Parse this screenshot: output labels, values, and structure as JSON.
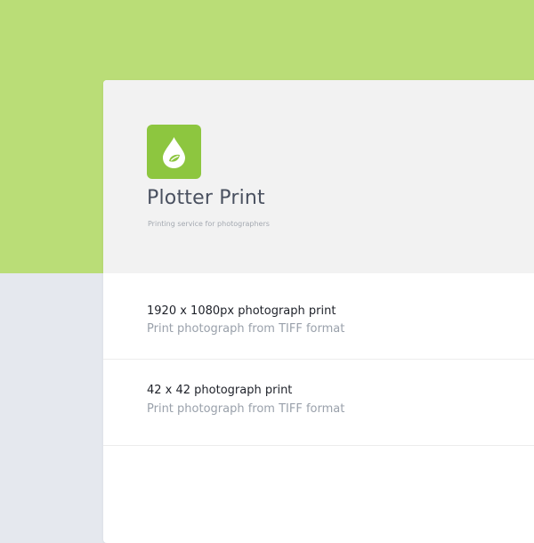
{
  "colors": {
    "accent_background": "#badd77",
    "page_background": "#e5e8ee",
    "logo_green": "#8dc63f",
    "card_header": "#f2f2f2",
    "title_text": "#4a5160",
    "muted_text": "#9aa1ab"
  },
  "header": {
    "logo_icon": "water-drop-leaf-icon",
    "title": "Plotter Print",
    "subtitle": "Printing service for photographers"
  },
  "items": [
    {
      "title": "1920 x 1080px photograph print",
      "subtitle": "Print photograph from TIFF format"
    },
    {
      "title": "42 x 42 photograph print",
      "subtitle": "Print photograph from TIFF format"
    }
  ]
}
